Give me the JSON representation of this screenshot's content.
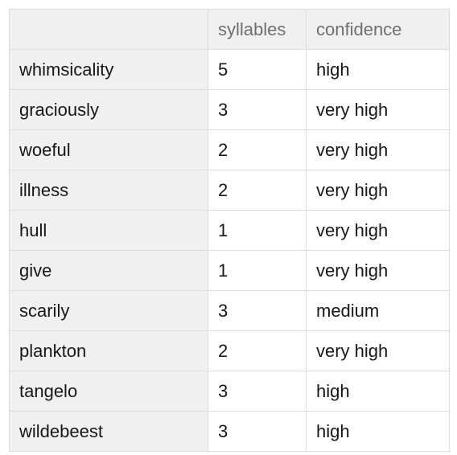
{
  "table": {
    "columns": [
      {
        "key": "word",
        "label": ""
      },
      {
        "key": "syllables",
        "label": "syllables"
      },
      {
        "key": "confidence",
        "label": "confidence"
      }
    ],
    "rows": [
      {
        "word": "whimsicality",
        "syllables": "5",
        "confidence": "high"
      },
      {
        "word": "graciously",
        "syllables": "3",
        "confidence": "very high"
      },
      {
        "word": "woeful",
        "syllables": "2",
        "confidence": "very high"
      },
      {
        "word": "illness",
        "syllables": "2",
        "confidence": "very high"
      },
      {
        "word": "hull",
        "syllables": "1",
        "confidence": "very high"
      },
      {
        "word": "give",
        "syllables": "1",
        "confidence": "very high"
      },
      {
        "word": "scarily",
        "syllables": "3",
        "confidence": "medium"
      },
      {
        "word": "plankton",
        "syllables": "2",
        "confidence": "very high"
      },
      {
        "word": "tangelo",
        "syllables": "3",
        "confidence": "high"
      },
      {
        "word": "wildebeest",
        "syllables": "3",
        "confidence": "high"
      }
    ]
  },
  "colors": {
    "header_background": "#f0f0f0",
    "header_text": "#6f6f6f",
    "body_text": "#171717",
    "cell_background": "#ffffff",
    "border": "#dcdcdc"
  }
}
